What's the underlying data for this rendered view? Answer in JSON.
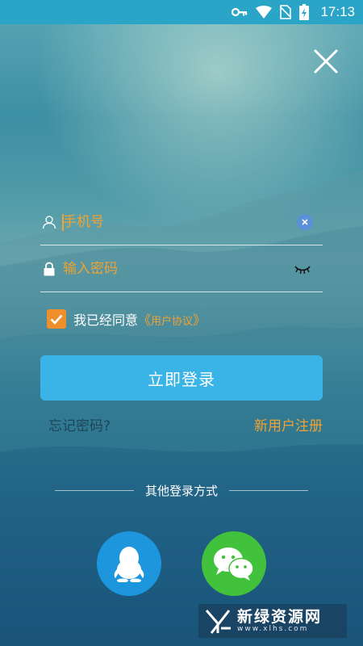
{
  "status_bar": {
    "time": "17:13",
    "icons": [
      "key-icon",
      "wifi-icon",
      "no-sim-icon",
      "battery-charging-icon"
    ]
  },
  "close_icon": "close-icon",
  "form": {
    "phone": {
      "placeholder": "手机号",
      "value": "",
      "leading_icon": "user-icon",
      "clear_icon": "clear-icon"
    },
    "password": {
      "placeholder": "输入密码",
      "value": "",
      "leading_icon": "lock-icon",
      "toggle_icon": "eye-closed-icon"
    },
    "agreement": {
      "checked": true,
      "prefix": "我已经同意",
      "open_mark": "《",
      "link": "用户协议",
      "close_mark": "》"
    },
    "login_label": "立即登录",
    "forgot_label": "忘记密码?",
    "register_label": "新用户注册"
  },
  "other_login": {
    "label": "其他登录方式",
    "providers": [
      {
        "name": "QQ",
        "icon": "qq-icon",
        "color": "#1d96de"
      },
      {
        "name": "WeChat",
        "icon": "wechat-icon",
        "color": "#42c23c"
      }
    ]
  },
  "watermark": {
    "title": "新绿资源网",
    "url": "www.xlhs.com"
  },
  "colors": {
    "accent": "#f1a232",
    "button": "#3ab4e6",
    "status_bar": "#2aa5c7"
  }
}
